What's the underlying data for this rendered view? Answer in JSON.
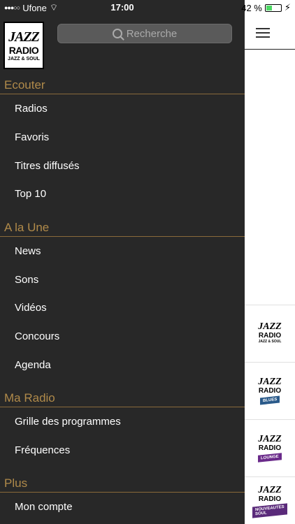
{
  "status": {
    "carrier": "Ufone",
    "time": "17:00",
    "battery": "42 %",
    "battery_level": 0.42
  },
  "logo": {
    "line1": "JAZZ",
    "line2": "RADIO",
    "line3": "JAZZ & SOUL"
  },
  "search": {
    "placeholder": "Recherche"
  },
  "sections": [
    {
      "title": "Ecouter",
      "items": [
        "Radios",
        "Favoris",
        "Titres diffusés",
        "Top 10"
      ]
    },
    {
      "title": "A la Une",
      "items": [
        "News",
        "Sons",
        "Vidéos",
        "Concours",
        "Agenda"
      ]
    },
    {
      "title": "Ma Radio",
      "items": [
        "Grille des programmes",
        "Fréquences"
      ]
    },
    {
      "title": "Plus",
      "items": [
        "Mon compte"
      ]
    }
  ],
  "stations": [
    {
      "line1": "JAZZ",
      "line2": "RADIO",
      "line3": "JAZZ & SOUL",
      "ribbon": "",
      "color": ""
    },
    {
      "line1": "JAZZ",
      "line2": "RADIO",
      "line3": "",
      "ribbon": "BLUES",
      "color": "#2a5a8a"
    },
    {
      "line1": "JAZZ",
      "line2": "RADIO",
      "line3": "",
      "ribbon": "LOUNGE",
      "color": "#6a2a8a"
    },
    {
      "line1": "JAZZ",
      "line2": "RADIO",
      "line3": "",
      "ribbon": "NOUVEAUTES SOUL",
      "color": "#5a2a7a"
    }
  ]
}
